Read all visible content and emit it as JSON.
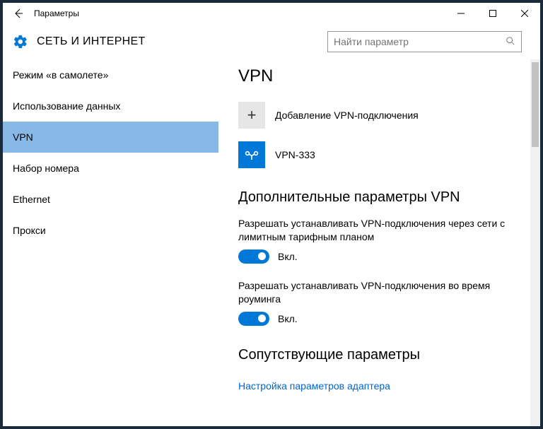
{
  "window": {
    "title": "Параметры"
  },
  "header": {
    "heading": "СЕТЬ И ИНТЕРНЕТ"
  },
  "search": {
    "placeholder": "Найти параметр"
  },
  "sidebar": {
    "items": [
      {
        "label": "Режим «в самолете»",
        "selected": false
      },
      {
        "label": "Использование данных",
        "selected": false
      },
      {
        "label": "VPN",
        "selected": true
      },
      {
        "label": "Набор номера",
        "selected": false
      },
      {
        "label": "Ethernet",
        "selected": false
      },
      {
        "label": "Прокси",
        "selected": false
      }
    ]
  },
  "main": {
    "title": "VPN",
    "add_label": "Добавление VPN-подключения",
    "connections": [
      {
        "name": "VPN-333"
      }
    ],
    "advanced_heading": "Дополнительные параметры VPN",
    "toggle1_desc": "Разрешать устанавливать VPN-подключения через сети с лимитным тарифным планом",
    "toggle1_state": "Вкл.",
    "toggle2_desc": "Разрешать устанавливать VPN-подключения во время роуминга",
    "toggle2_state": "Вкл.",
    "related_heading": "Сопутствующие параметры",
    "adapter_link": "Настройка параметров адаптера"
  }
}
